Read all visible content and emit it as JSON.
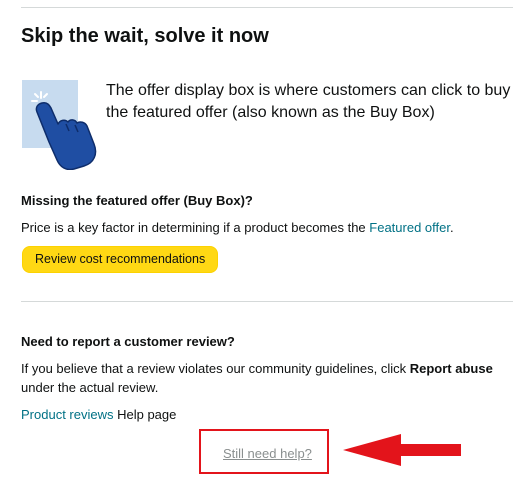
{
  "header": {
    "title": "Skip the wait, solve it now"
  },
  "hero": {
    "illustration_icon": "hand-pointing-tap-icon",
    "text": "The offer display box is where customers can click to buy the featured offer (also known as the Buy Box)"
  },
  "buybox": {
    "title": "Missing the featured offer (Buy Box)?",
    "body_prefix": "Price is a key factor in determining if a product becomes the ",
    "body_link": "Featured offer",
    "body_suffix": ".",
    "button_label": "Review cost recommendations"
  },
  "report": {
    "title": "Need to report a customer review?",
    "body_prefix": "If you believe that a review violates our community guidelines, click ",
    "body_bold": "Report abuse",
    "body_suffix": " under the actual review.",
    "link_label": "Product reviews",
    "link_suffix": " Help page"
  },
  "help": {
    "link_label": "Still need help?"
  },
  "colors": {
    "accent_link": "#007185",
    "button_bg": "#ffd814",
    "annotation_red": "#e3141b",
    "illustration_bg": "#c7dbef",
    "illustration_hand": "#1f4ea3"
  }
}
